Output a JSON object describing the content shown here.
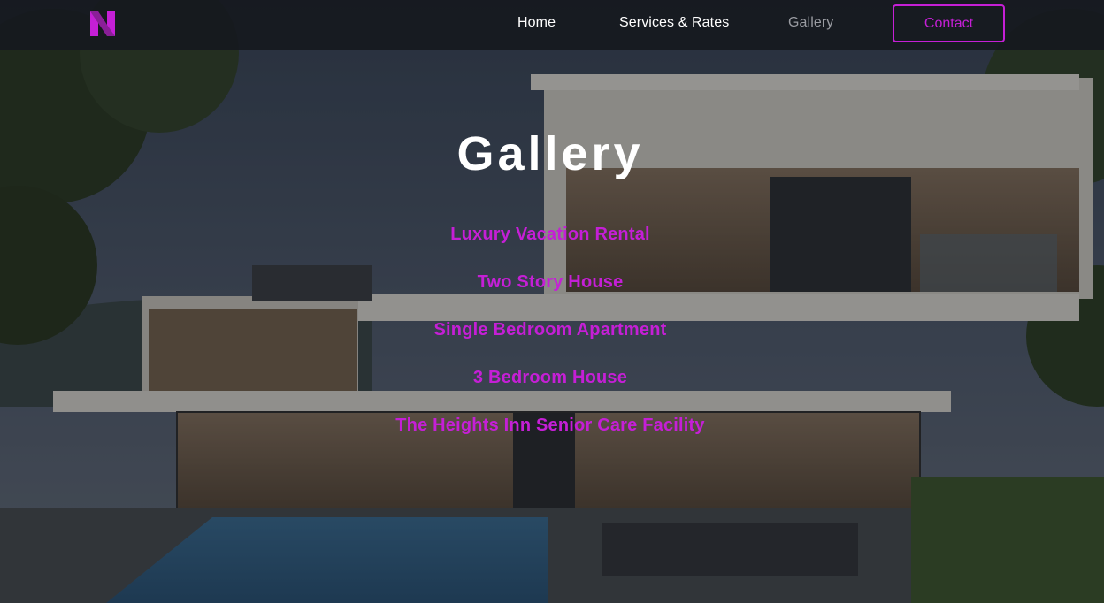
{
  "colors": {
    "accent": "#c51fd6",
    "nav_bg": "#16191e",
    "nav_text": "#ffffff",
    "nav_active": "#9a9ca2",
    "title": "#ffffff"
  },
  "nav": {
    "logo_icon": "letter-n-logo",
    "items": [
      {
        "label": "Home"
      },
      {
        "label": "Services & Rates"
      },
      {
        "label": "Gallery"
      }
    ],
    "contact_label": "Contact"
  },
  "main": {
    "title": "Gallery",
    "links": [
      {
        "label": "Luxury Vacation Rental"
      },
      {
        "label": "Two Story House"
      },
      {
        "label": "Single Bedroom Apartment"
      },
      {
        "label": "3 Bedroom House"
      },
      {
        "label": "The Heights Inn Senior Care Facility"
      }
    ]
  }
}
